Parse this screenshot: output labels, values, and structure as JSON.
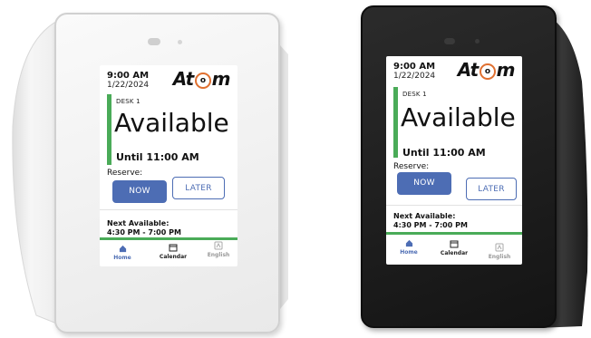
{
  "screen": {
    "time": "9:00 AM",
    "date": "1/22/2024",
    "logo_left": "At",
    "logo_mid": "o",
    "logo_right": "m",
    "desk": "DESK 1",
    "status": "Available",
    "until": "Until 11:00 AM",
    "reserve_label": "Reserve:",
    "now_button": "NOW",
    "later_button": "LATER",
    "next_label": "Next Available:",
    "next_time": "4:30 PM - 7:00 PM",
    "nav": {
      "home": "Home",
      "calendar": "Calendar",
      "english": "English"
    }
  },
  "colors": {
    "accent_green": "#4aab58",
    "button_blue": "#4d6db4",
    "logo_orange": "#e07030",
    "white_device": "#f3f3f3",
    "black_device": "#1c1c1c"
  }
}
